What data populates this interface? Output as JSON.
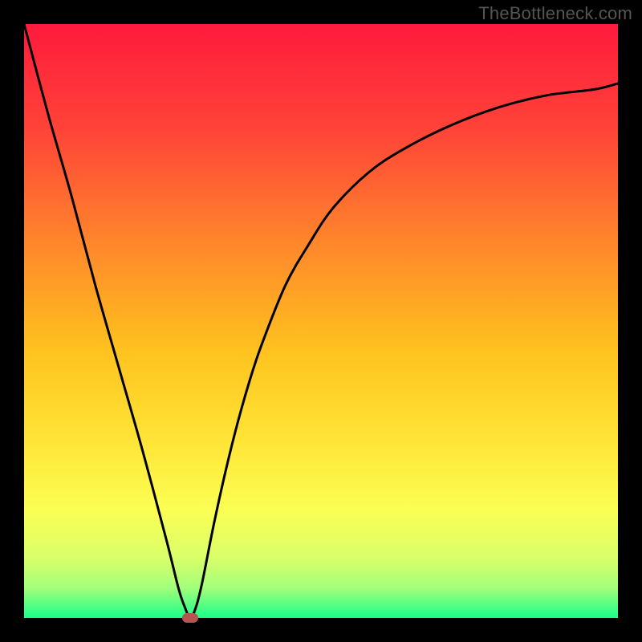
{
  "watermark": "TheBottleneck.com",
  "chart_data": {
    "type": "line",
    "title": "",
    "xlabel": "",
    "ylabel": "",
    "xlim": [
      0,
      100
    ],
    "ylim": [
      0,
      100
    ],
    "grid": false,
    "legend": false,
    "background_gradient_stops": [
      {
        "offset": 0.0,
        "color": "#ff1a3c"
      },
      {
        "offset": 0.18,
        "color": "#ff4438"
      },
      {
        "offset": 0.38,
        "color": "#ff8a2a"
      },
      {
        "offset": 0.55,
        "color": "#ffc21e"
      },
      {
        "offset": 0.72,
        "color": "#ffe93a"
      },
      {
        "offset": 0.82,
        "color": "#fbff54"
      },
      {
        "offset": 0.9,
        "color": "#d8ff6a"
      },
      {
        "offset": 0.95,
        "color": "#a2ff7a"
      },
      {
        "offset": 1.0,
        "color": "#19ff89"
      }
    ],
    "series": [
      {
        "name": "bottleneck-curve",
        "color": "#000000",
        "x": [
          0,
          4,
          8,
          12,
          16,
          20,
          24,
          26,
          27,
          28,
          29,
          30,
          32,
          34,
          36,
          38,
          40,
          44,
          48,
          52,
          58,
          64,
          72,
          80,
          88,
          96,
          100
        ],
        "y": [
          100,
          85,
          71,
          56,
          42,
          28,
          13,
          5,
          2,
          0,
          2,
          6,
          16,
          25,
          33,
          40,
          46,
          56,
          63,
          69,
          75,
          79,
          83,
          86,
          88,
          89,
          90
        ]
      }
    ],
    "marker": {
      "x": 28,
      "y": 0,
      "color": "#b85450"
    }
  }
}
